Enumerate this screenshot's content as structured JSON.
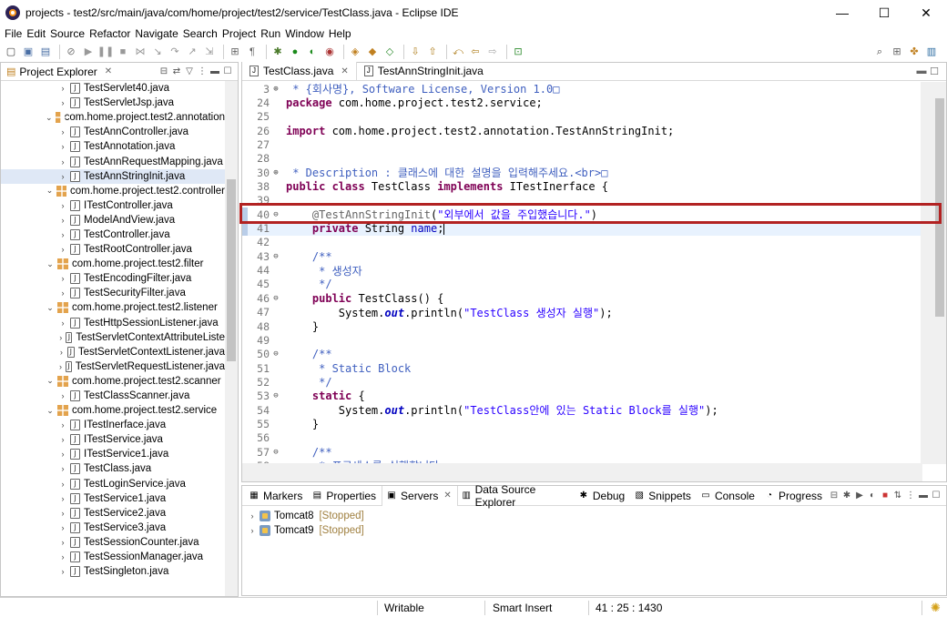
{
  "window": {
    "title": "projects - test2/src/main/java/com/home/project/test2/service/TestClass.java - Eclipse IDE",
    "minimize": "—",
    "maximize": "☐",
    "close": "✕"
  },
  "menu": [
    "File",
    "Edit",
    "Source",
    "Refactor",
    "Navigate",
    "Search",
    "Project",
    "Run",
    "Window",
    "Help"
  ],
  "project_explorer": {
    "title": "Project Explorer",
    "items": [
      {
        "kind": "file",
        "label": "TestServlet40.java",
        "indent": 2
      },
      {
        "kind": "file",
        "label": "TestServletJsp.java",
        "indent": 2
      },
      {
        "kind": "package",
        "label": "com.home.project.test2.annotation",
        "indent": 1
      },
      {
        "kind": "file",
        "label": "TestAnnController.java",
        "indent": 2
      },
      {
        "kind": "ifile",
        "label": "TestAnnotation.java",
        "indent": 2
      },
      {
        "kind": "file",
        "label": "TestAnnRequestMapping.java",
        "indent": 2
      },
      {
        "kind": "file",
        "label": "TestAnnStringInit.java",
        "indent": 2,
        "selected": true
      },
      {
        "kind": "package",
        "label": "com.home.project.test2.controller",
        "indent": 1
      },
      {
        "kind": "ifile",
        "label": "ITestController.java",
        "indent": 2
      },
      {
        "kind": "file",
        "label": "ModelAndView.java",
        "indent": 2
      },
      {
        "kind": "file",
        "label": "TestController.java",
        "indent": 2
      },
      {
        "kind": "file",
        "label": "TestRootController.java",
        "indent": 2
      },
      {
        "kind": "package",
        "label": "com.home.project.test2.filter",
        "indent": 1
      },
      {
        "kind": "file",
        "label": "TestEncodingFilter.java",
        "indent": 2
      },
      {
        "kind": "file",
        "label": "TestSecurityFilter.java",
        "indent": 2
      },
      {
        "kind": "package",
        "label": "com.home.project.test2.listener",
        "indent": 1
      },
      {
        "kind": "file",
        "label": "TestHttpSessionListener.java",
        "indent": 2
      },
      {
        "kind": "file",
        "label": "TestServletContextAttributeListe",
        "indent": 2
      },
      {
        "kind": "file",
        "label": "TestServletContextListener.java",
        "indent": 2
      },
      {
        "kind": "file",
        "label": "TestServletRequestListener.java",
        "indent": 2
      },
      {
        "kind": "package",
        "label": "com.home.project.test2.scanner",
        "indent": 1
      },
      {
        "kind": "file",
        "label": "TestClassScanner.java",
        "indent": 2
      },
      {
        "kind": "package",
        "label": "com.home.project.test2.service",
        "indent": 1
      },
      {
        "kind": "ifile",
        "label": "ITestInerface.java",
        "indent": 2
      },
      {
        "kind": "ifile",
        "label": "ITestService.java",
        "indent": 2
      },
      {
        "kind": "ifile",
        "label": "ITestService1.java",
        "indent": 2
      },
      {
        "kind": "file",
        "label": "TestClass.java",
        "indent": 2
      },
      {
        "kind": "file",
        "label": "TestLoginService.java",
        "indent": 2
      },
      {
        "kind": "file",
        "label": "TestService1.java",
        "indent": 2
      },
      {
        "kind": "file",
        "label": "TestService2.java",
        "indent": 2
      },
      {
        "kind": "file",
        "label": "TestService3.java",
        "indent": 2
      },
      {
        "kind": "file",
        "label": "TestSessionCounter.java",
        "indent": 2
      },
      {
        "kind": "file",
        "label": "TestSessionManager.java",
        "indent": 2
      },
      {
        "kind": "file",
        "label": "TestSingleton.java",
        "indent": 2
      }
    ]
  },
  "editor": {
    "tabs": [
      {
        "label": "TestClass.java",
        "active": true
      },
      {
        "label": "TestAnnStringInit.java",
        "active": false
      }
    ],
    "lines": [
      {
        "n": "3",
        "fold": "⊕",
        "parts": [
          {
            "c": "cm",
            "t": " * {회사명}, Software License, Version 1.0"
          },
          {
            "c": "cm",
            "t": "□"
          }
        ]
      },
      {
        "n": "24",
        "fold": "",
        "parts": [
          {
            "c": "kw",
            "t": "package"
          },
          {
            "c": "",
            "t": " com.home.project.test2.service;"
          }
        ]
      },
      {
        "n": "25",
        "fold": "",
        "parts": []
      },
      {
        "n": "26",
        "fold": "",
        "parts": [
          {
            "c": "kw",
            "t": "import"
          },
          {
            "c": "",
            "t": " com.home.project.test2.annotation.TestAnnStringInit;"
          }
        ]
      },
      {
        "n": "27",
        "fold": "",
        "parts": []
      },
      {
        "n": "28",
        "fold": "",
        "parts": []
      },
      {
        "n": "30",
        "fold": "⊕",
        "parts": [
          {
            "c": "cm",
            "t": " * Description : 클래스에 대한 설명을 입력해주세요.<br>□"
          }
        ]
      },
      {
        "n": "38",
        "fold": "",
        "parts": [
          {
            "c": "kw",
            "t": "public class"
          },
          {
            "c": "",
            "t": " TestClass "
          },
          {
            "c": "kw",
            "t": "implements"
          },
          {
            "c": "",
            "t": " ITestInerface {"
          }
        ]
      },
      {
        "n": "39",
        "fold": "",
        "parts": []
      },
      {
        "n": "40",
        "fold": "⊖",
        "parts": [
          {
            "c": "",
            "t": "    "
          },
          {
            "c": "ann",
            "t": "@TestAnnStringInit"
          },
          {
            "c": "",
            "t": "("
          },
          {
            "c": "str",
            "t": "\"외부에서 값을 주입했습니다.\""
          },
          {
            "c": "",
            "t": ")"
          }
        ]
      },
      {
        "n": "41",
        "fold": "",
        "current": true,
        "parts": [
          {
            "c": "",
            "t": "    "
          },
          {
            "c": "kw",
            "t": "private"
          },
          {
            "c": "",
            "t": " String "
          },
          {
            "c": "fld",
            "t": "name"
          },
          {
            "c": "",
            "t": ";"
          }
        ]
      },
      {
        "n": "42",
        "fold": "",
        "parts": []
      },
      {
        "n": "43",
        "fold": "⊖",
        "parts": [
          {
            "c": "cm",
            "t": "    /**"
          }
        ]
      },
      {
        "n": "44",
        "fold": "",
        "parts": [
          {
            "c": "cm",
            "t": "     * 생성자"
          }
        ]
      },
      {
        "n": "45",
        "fold": "",
        "parts": [
          {
            "c": "cm",
            "t": "     */"
          }
        ]
      },
      {
        "n": "46",
        "fold": "⊖",
        "parts": [
          {
            "c": "",
            "t": "    "
          },
          {
            "c": "kw",
            "t": "public"
          },
          {
            "c": "",
            "t": " TestClass() {"
          }
        ]
      },
      {
        "n": "47",
        "fold": "",
        "parts": [
          {
            "c": "",
            "t": "        System."
          },
          {
            "c": "ital",
            "t": "out"
          },
          {
            "c": "",
            "t": ".println("
          },
          {
            "c": "str",
            "t": "\"TestClass 생성자 실행\""
          },
          {
            "c": "",
            "t": ");"
          }
        ]
      },
      {
        "n": "48",
        "fold": "",
        "parts": [
          {
            "c": "",
            "t": "    }"
          }
        ]
      },
      {
        "n": "49",
        "fold": "",
        "parts": []
      },
      {
        "n": "50",
        "fold": "⊖",
        "parts": [
          {
            "c": "cm",
            "t": "    /**"
          }
        ]
      },
      {
        "n": "51",
        "fold": "",
        "parts": [
          {
            "c": "cm",
            "t": "     * Static Block"
          }
        ]
      },
      {
        "n": "52",
        "fold": "",
        "parts": [
          {
            "c": "cm",
            "t": "     */"
          }
        ]
      },
      {
        "n": "53",
        "fold": "⊖",
        "parts": [
          {
            "c": "",
            "t": "    "
          },
          {
            "c": "kw",
            "t": "static"
          },
          {
            "c": "",
            "t": " {"
          }
        ]
      },
      {
        "n": "54",
        "fold": "",
        "parts": [
          {
            "c": "",
            "t": "        System."
          },
          {
            "c": "ital",
            "t": "out"
          },
          {
            "c": "",
            "t": ".println("
          },
          {
            "c": "str",
            "t": "\"TestClass안에 있는 Static Block를 실행\""
          },
          {
            "c": "",
            "t": ");"
          }
        ]
      },
      {
        "n": "55",
        "fold": "",
        "parts": [
          {
            "c": "",
            "t": "    }"
          }
        ]
      },
      {
        "n": "56",
        "fold": "",
        "parts": []
      },
      {
        "n": "57",
        "fold": "⊖",
        "parts": [
          {
            "c": "cm",
            "t": "    /**"
          }
        ]
      },
      {
        "n": "58",
        "fold": "",
        "parts": [
          {
            "c": "cm",
            "t": "     * 프로세스를 실행합니다."
          }
        ]
      }
    ]
  },
  "bottom_panel": {
    "tabs": [
      {
        "label": "Markers",
        "icon": "markers-icon",
        "glyph": "▦",
        "active": false
      },
      {
        "label": "Properties",
        "icon": "properties-icon",
        "glyph": "▤",
        "active": false
      },
      {
        "label": "Servers",
        "icon": "servers-icon",
        "glyph": "▣",
        "active": true
      },
      {
        "label": "Data Source Explorer",
        "icon": "datasource-icon",
        "glyph": "▥",
        "active": false
      },
      {
        "label": "Debug",
        "icon": "debug-icon",
        "glyph": "✱",
        "active": false
      },
      {
        "label": "Snippets",
        "icon": "snippets-icon",
        "glyph": "▧",
        "active": false
      },
      {
        "label": "Console",
        "icon": "console-icon",
        "glyph": "▭",
        "active": false
      },
      {
        "label": "Progress",
        "icon": "progress-icon",
        "glyph": "◔",
        "active": false
      }
    ],
    "servers": [
      {
        "name": "Tomcat8",
        "status": "[Stopped]"
      },
      {
        "name": "Tomcat9",
        "status": "[Stopped]"
      }
    ]
  },
  "status_bar": {
    "mode": "Writable",
    "insert": "Smart Insert",
    "position": "41 : 25 : 1430"
  },
  "colors": {
    "keyword": "#7f0055",
    "comment": "#3f5fbf",
    "string": "#2a00ff",
    "highlight_box": "#b22222",
    "selection": "#dfe8f6"
  }
}
